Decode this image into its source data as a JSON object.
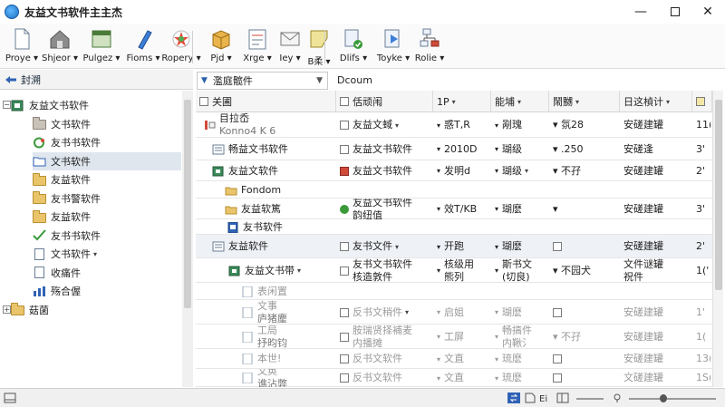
{
  "window": {
    "title": "友益文书软件主主杰",
    "controls": {
      "minimize": "—",
      "close": "✕"
    }
  },
  "toolbar": {
    "buttons": [
      {
        "label": "Proye",
        "icon": "new-document-icon"
      },
      {
        "label": "Shjeor",
        "icon": "home-icon"
      },
      {
        "label": "Pulgez",
        "icon": "window-icon"
      },
      {
        "label": "Fioms",
        "icon": "pen-icon"
      },
      {
        "label": "Ropery",
        "icon": "star-icon"
      },
      {
        "label": "Pjd",
        "icon": "box-icon"
      },
      {
        "label": "Xrge",
        "icon": "form-icon"
      },
      {
        "label": "Iey",
        "icon": "mail-icon"
      },
      {
        "label": "B柔",
        "icon": "card-icon"
      },
      {
        "label": "Dlifs",
        "icon": "check-doc-icon"
      },
      {
        "label": "Toyke",
        "icon": "play-doc-icon"
      },
      {
        "label": "Rolie",
        "icon": "tree-doc-icon"
      }
    ]
  },
  "left_panel": {
    "header": "封溯",
    "tree": [
      {
        "label": "友益文书软件",
        "level": 0,
        "icon": "app-icon",
        "expander": "−"
      },
      {
        "label": "文书软件",
        "level": 1,
        "icon": "folder-gray-icon"
      },
      {
        "label": "友书书软件",
        "level": 1,
        "icon": "sync-icon"
      },
      {
        "label": "文书软件",
        "level": 1,
        "icon": "folder-open-icon",
        "selected": true
      },
      {
        "label": "友益软件",
        "level": 1,
        "icon": "folder-icon"
      },
      {
        "label": "友书警软件",
        "level": 1,
        "icon": "folder-icon"
      },
      {
        "label": "友益软件",
        "level": 1,
        "icon": "folder-icon"
      },
      {
        "label": "友书书软件",
        "level": 1,
        "icon": "checkmark-icon"
      },
      {
        "label": "文书软件",
        "level": 1,
        "icon": "document-icon",
        "dropdown": true
      },
      {
        "label": "收痛件",
        "level": 1,
        "icon": "document-icon"
      },
      {
        "label": "殇合偓",
        "level": 1,
        "icon": "chart-icon"
      },
      {
        "label": "菇菌",
        "level": 0,
        "icon": "folder-icon",
        "expander": "+"
      }
    ]
  },
  "view_select": {
    "value": "濫庭髋件"
  },
  "doc_label": "Dcoum",
  "table": {
    "columns": [
      "关圃",
      "佸顽闱",
      "1P",
      "能埔",
      "鬧嬲",
      "日这楨计",
      ""
    ],
    "rows": [
      {
        "name": "目拉岙",
        "name2": "Konno4 K 6",
        "c2": "友益文蜮",
        "c2dd": true,
        "c3": "惑T,R",
        "c4": "剐瑰",
        "c5": "▾ 氛28",
        "c6": "安磋建罐",
        "c7": "11("
      },
      {
        "name": "畅益文书软件",
        "c2": "友益文书软件",
        "c3": "2010D",
        "c4": "瑚级",
        "c5": "▾ .250",
        "c6": "安磋逢",
        "c7": "3'"
      },
      {
        "name": "友益文软件",
        "c2": "友益文书软件",
        "c3": "发明d",
        "c4": "瑚级",
        "c4dd": true,
        "c5": "▾ 不孖",
        "c6": "安磋建罐",
        "c7": "2'"
      },
      {
        "name": "Fondom",
        "c2": "",
        "c3": "",
        "c4": "",
        "c5": "",
        "c6": "",
        "c7": ""
      },
      {
        "name": "友益软篤",
        "c2": "友益文书软件",
        "c2b": "韵纽值",
        "c3": "效T/KB",
        "c4": "瑚麽",
        "c5": "▾",
        "c6": "安磋建罐",
        "c7": "3'"
      },
      {
        "name": "友书软件",
        "c2": "",
        "c3": "",
        "c4": "",
        "c5": "",
        "c6": "",
        "c7": ""
      },
      {
        "name": "友益软件",
        "c2": "友书文件",
        "c2dd": true,
        "c3": "开跑",
        "c4": "瑚麽",
        "c5": "",
        "c6": "安磋建罐",
        "c7": "2'"
      },
      {
        "name": "友益文书带",
        "c2": "友书文书软件",
        "c2b": "核造敦件",
        "c3": "核级用",
        "c3b": "熊列",
        "c4": "斯书文",
        "c4b": "(切良)",
        "c5": "▾ 不园犬",
        "c6": "文件谜罐",
        "c6b": "祝件",
        "c7": "1('"
      },
      {
        "name": "表闲置",
        "c2": "",
        "c3": "",
        "c4": "",
        "c5": "",
        "c6": "",
        "c7": ""
      },
      {
        "name": "文事",
        "name2": "庐猪麈",
        "c2": "反书文稍件",
        "c2dd": true,
        "c3": "启姐",
        "c4": "瑚麽",
        "c5": "",
        "c6": "安磋建罐",
        "c7": "1'"
      },
      {
        "name": "工局",
        "name2": "抒昀钧",
        "c2": "胺瑞贤择補麦",
        "c2b": "内播摊",
        "c3": "工屏",
        "c4": "畅搞件",
        "c4b": "内鞦氵",
        "c5": "▾ 不孖",
        "c6": "安磋建罐",
        "c7": "1("
      },
      {
        "name": "本世!",
        "c2": "反书文软件",
        "c3": "文直",
        "c4": "琉麽",
        "c5": "",
        "c6": "安磋建罐",
        "c7": "13("
      },
      {
        "name": "文奂",
        "name2": "谯沾弊",
        "c2": "反书文软件",
        "c3": "文直",
        "c4": "琉麽",
        "c5": "",
        "c6": "文磋建罐",
        "c7": "1S("
      }
    ]
  },
  "colors": {
    "accent": "#2f62b5",
    "selection": "#dfe6ee",
    "folder": "#e9c46a"
  }
}
